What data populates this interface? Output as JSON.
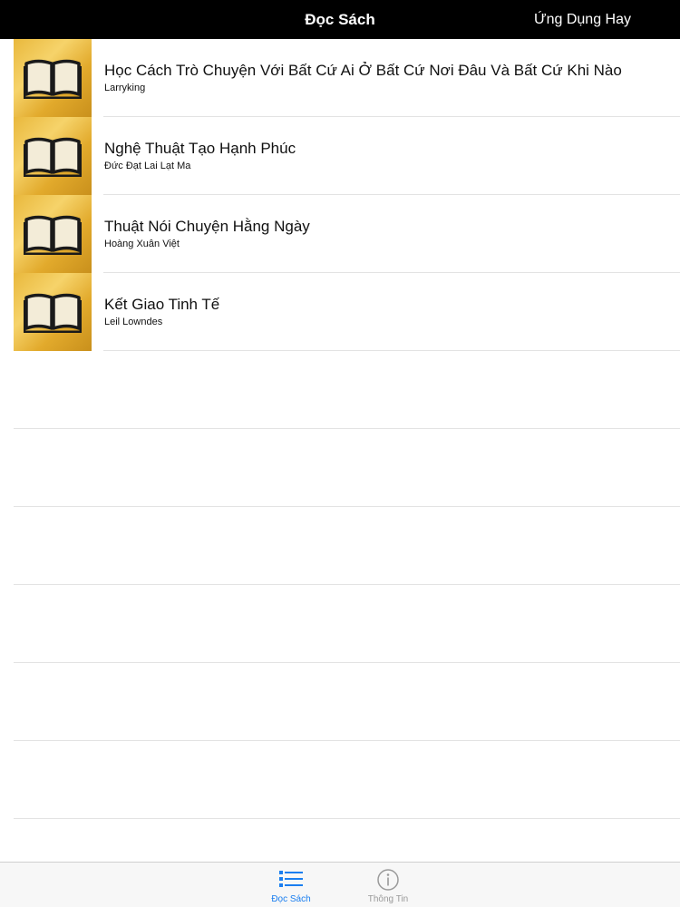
{
  "nav": {
    "title": "Đọc Sách",
    "right_button": "Ứng Dụng Hay"
  },
  "books": [
    {
      "title": "Học Cách Trò Chuyện Với Bất Cứ Ai Ở Bất Cứ Nơi Đâu Và Bất Cứ Khi Nào",
      "author": "Larryking"
    },
    {
      "title": "Nghệ Thuật Tạo Hạnh Phúc",
      "author": "Đức Đạt Lai Lạt Ma"
    },
    {
      "title": "Thuật Nói Chuyện Hằng Ngày",
      "author": "Hoàng Xuân Việt"
    },
    {
      "title": "Kết Giao Tinh Tế",
      "author": "Leil Lowndes"
    }
  ],
  "tabs": [
    {
      "label": "Đọc Sách",
      "icon": "list-icon",
      "active": true
    },
    {
      "label": "Thông Tin",
      "icon": "info-icon",
      "active": false
    }
  ],
  "colors": {
    "nav_background": "#000000",
    "tab_active": "#1a7ef0",
    "tab_inactive": "#9a9a9a",
    "thumbnail_gold": "#e9b83c"
  }
}
